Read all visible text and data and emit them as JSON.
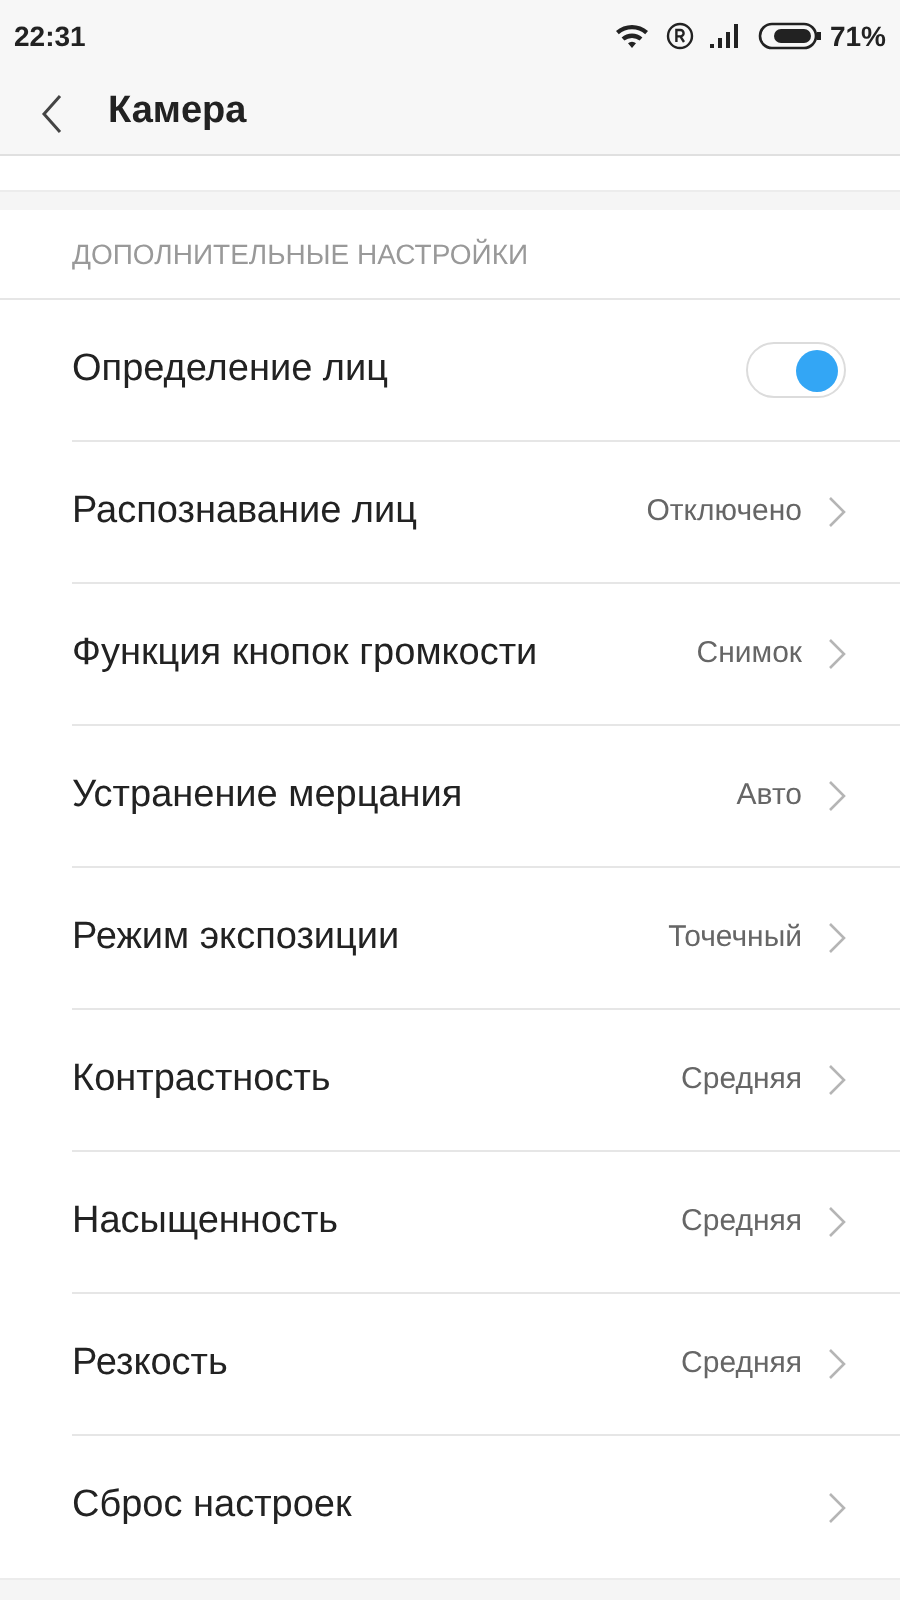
{
  "status_bar": {
    "time": "22:31",
    "battery": "71%"
  },
  "header": {
    "title": "Камера"
  },
  "section": {
    "title": "ДОПОЛНИТЕЛЬНЫЕ НАСТРОЙКИ"
  },
  "rows": [
    {
      "kind": "toggle",
      "label": "Определение лиц",
      "on": true
    },
    {
      "kind": "link",
      "label": "Распознавание лиц",
      "value": "Отключено"
    },
    {
      "kind": "link",
      "label": "Функция кнопок громкости",
      "value": "Снимок"
    },
    {
      "kind": "link",
      "label": "Устранение мерцания",
      "value": "Авто"
    },
    {
      "kind": "link",
      "label": "Режим экспозиции",
      "value": "Точечный"
    },
    {
      "kind": "link",
      "label": "Контрастность",
      "value": "Средняя"
    },
    {
      "kind": "link",
      "label": "Насыщенность",
      "value": "Средняя"
    },
    {
      "kind": "link",
      "label": "Резкость",
      "value": "Средняя"
    },
    {
      "kind": "link",
      "label": "Сброс настроек"
    }
  ]
}
